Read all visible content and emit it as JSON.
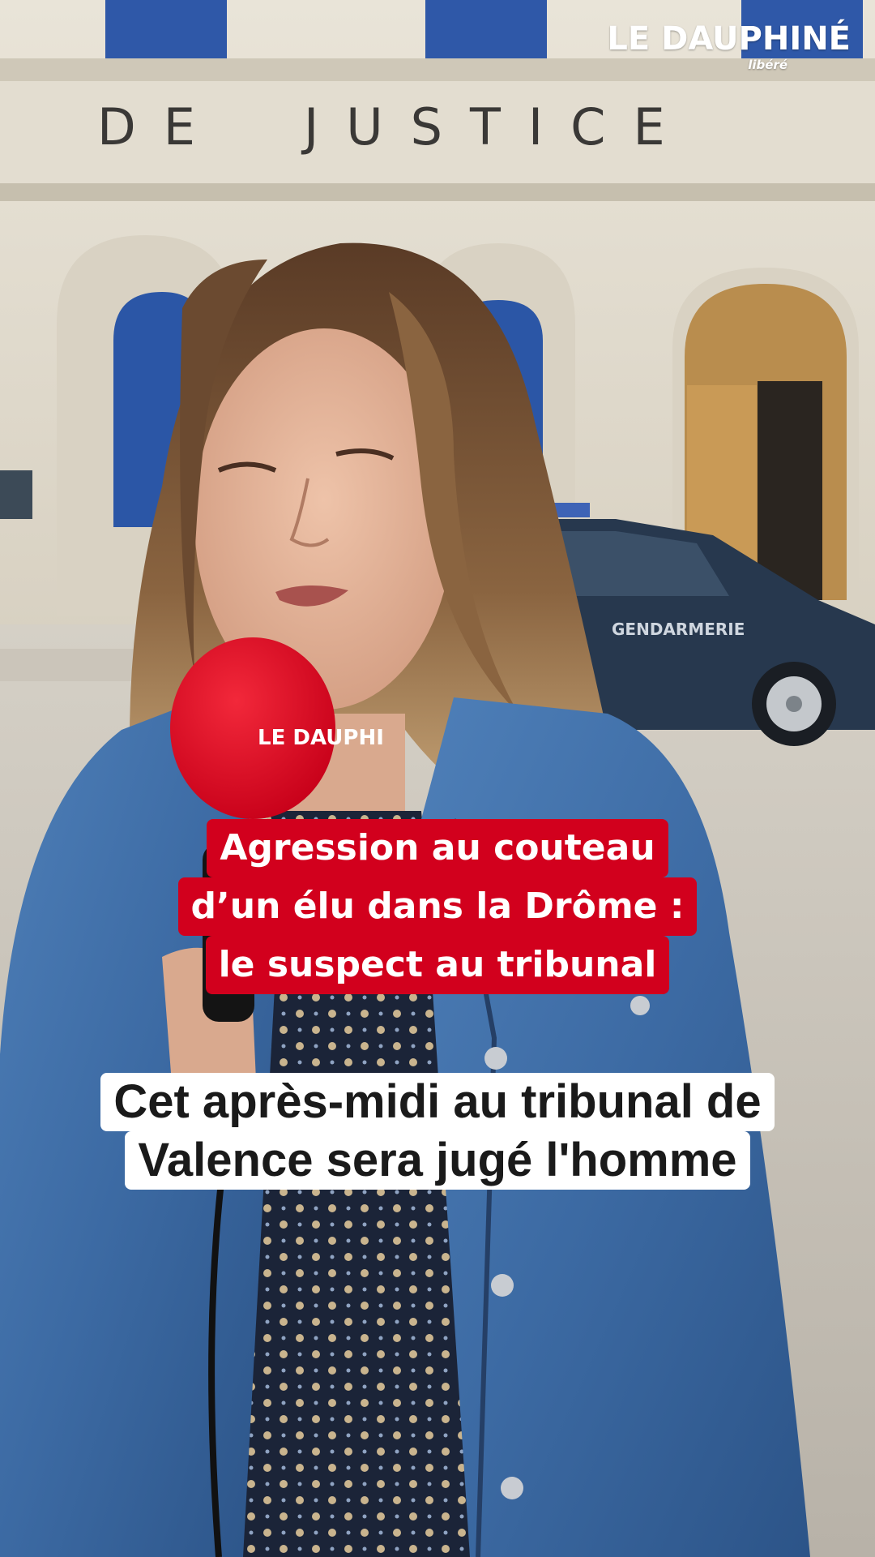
{
  "brand": {
    "name": "LE DAUPHINÉ",
    "tagline": "libéré"
  },
  "mic_flag": {
    "text": "LE DAUPHI"
  },
  "building": {
    "inscription": "DE JUSTICE"
  },
  "vehicle": {
    "label": "GENDARMERIE"
  },
  "headline": {
    "lines": [
      "Agression au couteau",
      "d’un élu dans la Drôme :",
      "le suspect au tribunal"
    ],
    "background": "#d2001d",
    "color": "#ffffff"
  },
  "subtitle": {
    "lines": [
      "Cet après-midi au tribunal de",
      "Valence sera jugé l'homme"
    ],
    "background": "#ffffff",
    "color": "#1a1a1a"
  }
}
